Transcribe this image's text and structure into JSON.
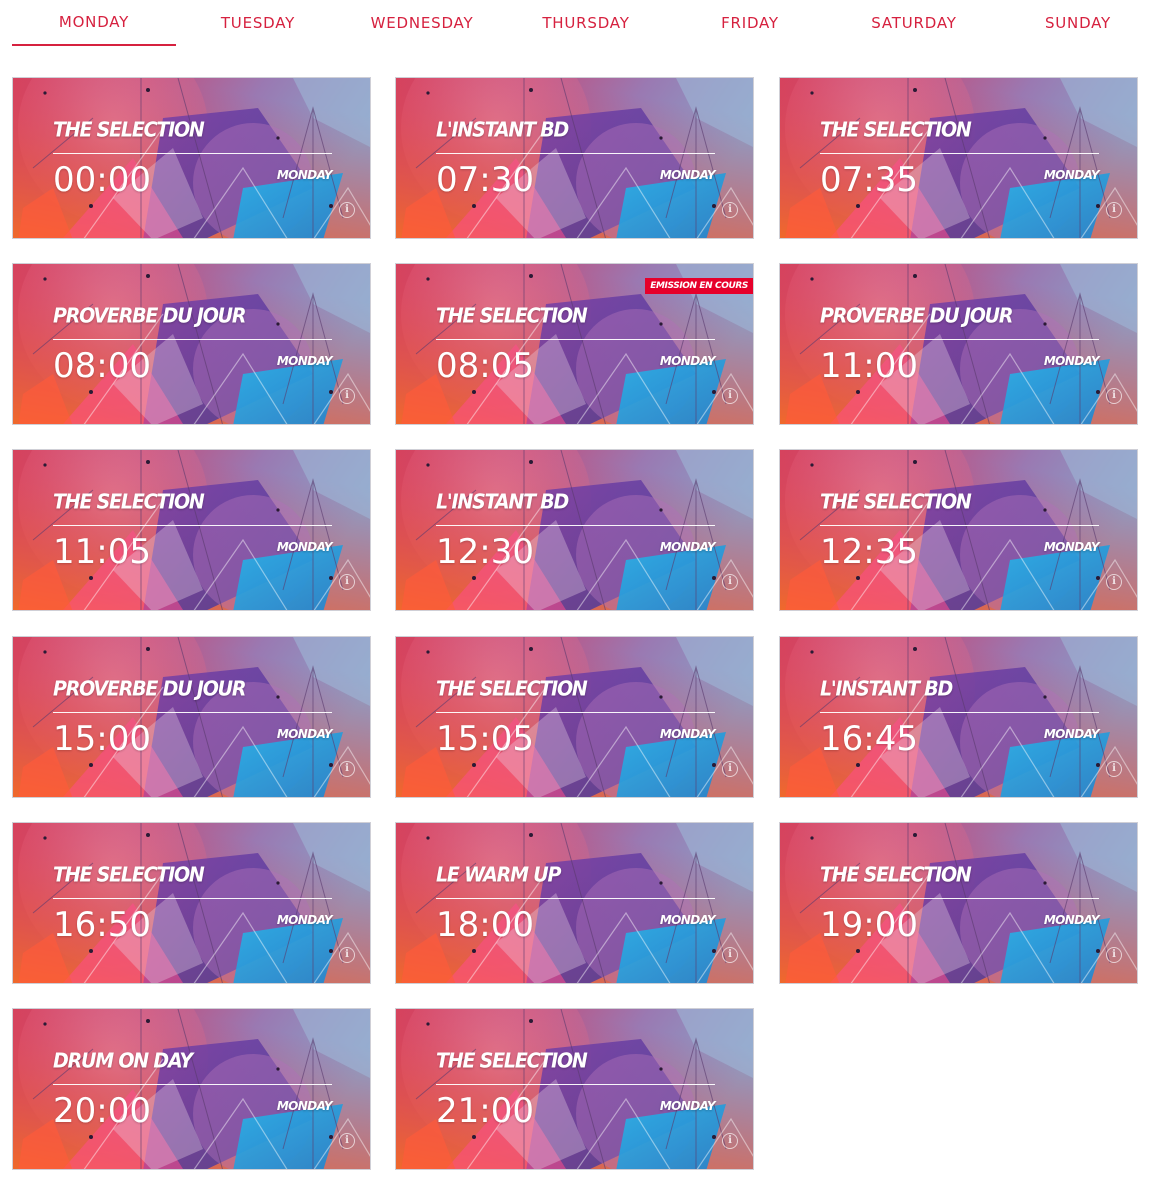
{
  "tabs": [
    {
      "label": "MONDAY",
      "active": true
    },
    {
      "label": "TUESDAY",
      "active": false
    },
    {
      "label": "WEDNESDAY",
      "active": false
    },
    {
      "label": "THURSDAY",
      "active": false
    },
    {
      "label": "FRIDAY",
      "active": false
    },
    {
      "label": "SATURDAY",
      "active": false
    },
    {
      "label": "SUNDAY",
      "active": false
    }
  ],
  "accent_color": "#d6213f",
  "badge_color": "#e6002b",
  "info_icon": "info-circle-icon",
  "shows": [
    {
      "title": "THE SELECTION",
      "time": "00:00",
      "day": "MONDAY",
      "badge": ""
    },
    {
      "title": "L'INSTANT BD",
      "time": "07:30",
      "day": "MONDAY",
      "badge": ""
    },
    {
      "title": "THE SELECTION",
      "time": "07:35",
      "day": "MONDAY",
      "badge": ""
    },
    {
      "title": "PROVERBE DU JOUR",
      "time": "08:00",
      "day": "MONDAY",
      "badge": ""
    },
    {
      "title": "THE SELECTION",
      "time": "08:05",
      "day": "MONDAY",
      "badge": "EMISSION EN COURS"
    },
    {
      "title": "PROVERBE DU JOUR",
      "time": "11:00",
      "day": "MONDAY",
      "badge": ""
    },
    {
      "title": "THE SELECTION",
      "time": "11:05",
      "day": "MONDAY",
      "badge": ""
    },
    {
      "title": "L'INSTANT BD",
      "time": "12:30",
      "day": "MONDAY",
      "badge": ""
    },
    {
      "title": "THE SELECTION",
      "time": "12:35",
      "day": "MONDAY",
      "badge": ""
    },
    {
      "title": "PROVERBE DU JOUR",
      "time": "15:00",
      "day": "MONDAY",
      "badge": ""
    },
    {
      "title": "THE SELECTION",
      "time": "15:05",
      "day": "MONDAY",
      "badge": ""
    },
    {
      "title": "L'INSTANT BD",
      "time": "16:45",
      "day": "MONDAY",
      "badge": ""
    },
    {
      "title": "THE SELECTION",
      "time": "16:50",
      "day": "MONDAY",
      "badge": ""
    },
    {
      "title": "LE WARM UP",
      "time": "18:00",
      "day": "MONDAY",
      "badge": ""
    },
    {
      "title": "THE SELECTION",
      "time": "19:00",
      "day": "MONDAY",
      "badge": ""
    },
    {
      "title": "DRUM ON DAY",
      "time": "20:00",
      "day": "MONDAY",
      "badge": ""
    },
    {
      "title": "THE SELECTION",
      "time": "21:00",
      "day": "MONDAY",
      "badge": ""
    }
  ]
}
